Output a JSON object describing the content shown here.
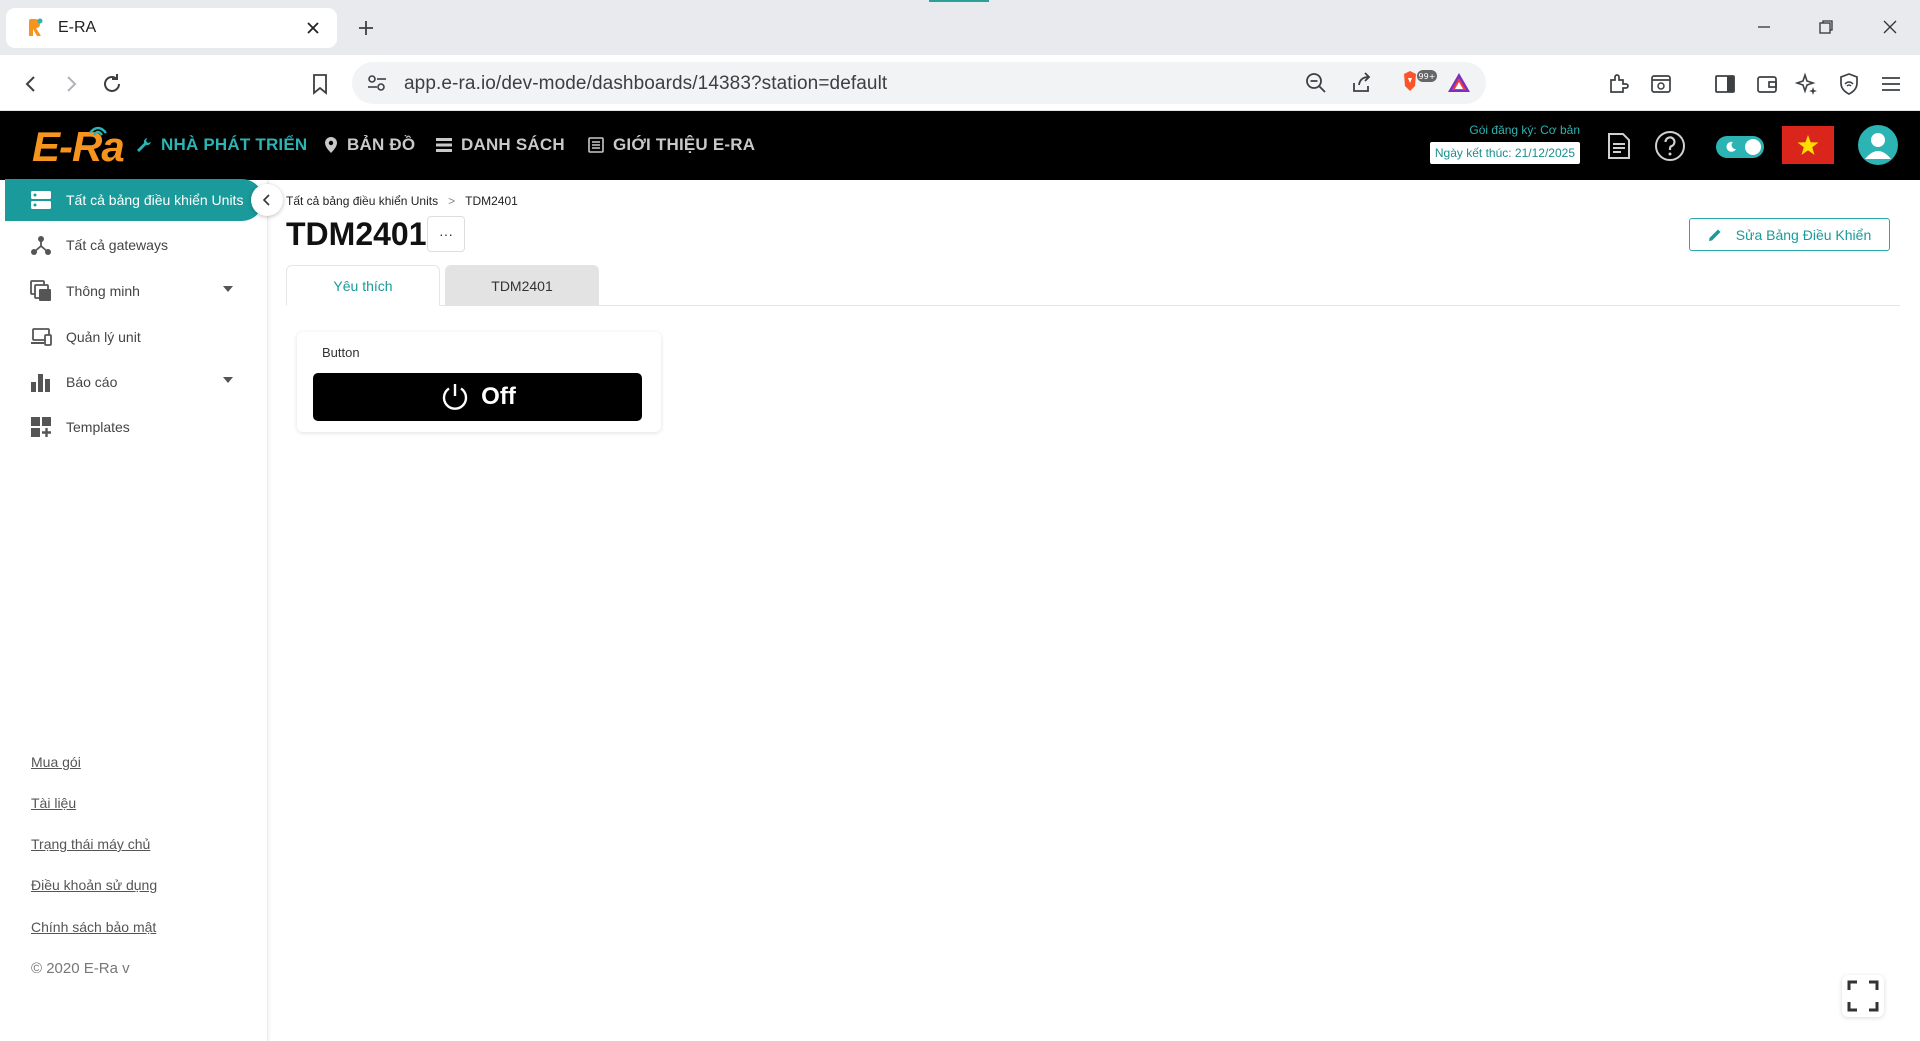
{
  "browser": {
    "tab_title": "E-RA",
    "url": "app.e-ra.io/dev-mode/dashboards/14383?station=default",
    "brave_badge": "99+"
  },
  "header": {
    "logo": "E-Ra",
    "nav": [
      {
        "label": "NHÀ PHÁT TRIỂN",
        "icon": "wrench-icon",
        "active": true
      },
      {
        "label": "BẢN ĐỒ",
        "icon": "map-pin-icon",
        "active": false
      },
      {
        "label": "DANH SÁCH",
        "icon": "list-icon",
        "active": false
      },
      {
        "label": "GIỚI THIỆU E-RA",
        "icon": "news-icon",
        "active": false
      }
    ],
    "subscription_plan": "Gói đăng ký: Cơ bản",
    "subscription_end": "Ngày kết thúc: 21/12/2025",
    "accent_color": "#2cb3b3"
  },
  "sidebar": {
    "items": [
      {
        "label": "Tất cả bảng điều khiển Units",
        "icon": "dashboard-icon",
        "active": true
      },
      {
        "label": "Tất cả gateways",
        "icon": "gateway-icon",
        "active": false
      },
      {
        "label": "Thông minh",
        "icon": "smart-icon",
        "active": false,
        "expandable": true
      },
      {
        "label": "Quản lý unit",
        "icon": "devices-icon",
        "active": false
      },
      {
        "label": "Báo cáo",
        "icon": "bar-chart-icon",
        "active": false,
        "expandable": true
      },
      {
        "label": "Templates",
        "icon": "templates-icon",
        "active": false
      }
    ],
    "footer_links": [
      "Mua gói",
      "Tài liệu",
      "Trạng thái máy chủ",
      "Điều khoản sử dụng",
      "Chính sách bảo mật"
    ],
    "copyright": "© 2020 E-Ra v"
  },
  "main": {
    "breadcrumb": [
      "Tất cả bảng điều khiển Units",
      "TDM2401"
    ],
    "breadcrumb_sep": ">",
    "title": "TDM2401",
    "more_label": "···",
    "edit_label": "Sửa Bảng Điều Khiển",
    "tabs": [
      {
        "label": "Yêu thích",
        "active": true
      },
      {
        "label": "TDM2401",
        "active": false
      }
    ],
    "widget": {
      "label": "Button",
      "state": "Off"
    }
  }
}
